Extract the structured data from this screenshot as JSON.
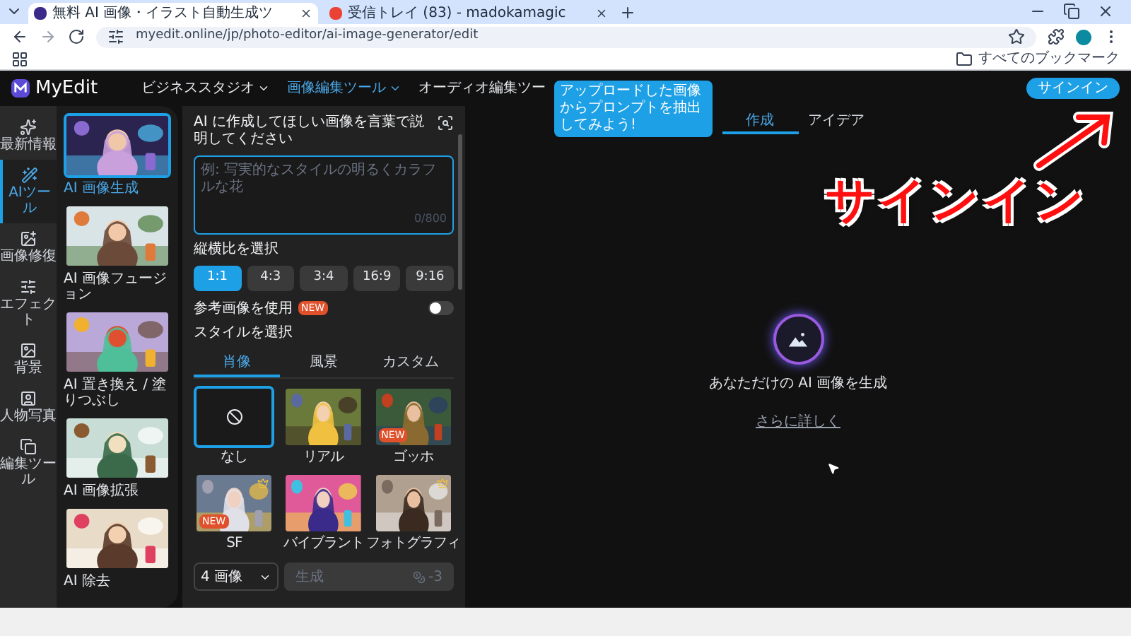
{
  "browser": {
    "tabs": [
      {
        "title": "無料 AI 画像・イラスト自動生成ツ",
        "selected": true
      },
      {
        "title": "受信トレイ (83) - madokamagic",
        "selected": false
      }
    ],
    "address": "myedit.online/jp/photo-editor/ai-image-generator/edit",
    "bookmarks": "すべてのブックマーク"
  },
  "header": {
    "logo": "MyEdit",
    "nav": [
      {
        "label": "ビジネススタジオ",
        "selected": false
      },
      {
        "label": "画像編集ツール",
        "selected": true
      },
      {
        "label": "オーディオ編集ツー",
        "selected": false
      }
    ],
    "sign_in": "サインイン"
  },
  "tooltip": "アップロードした画像からプロンプトを抽出してみよう!",
  "sidebar": {
    "items": [
      {
        "label": "最新情報",
        "selected": false
      },
      {
        "label": "AIツール",
        "selected": true
      },
      {
        "label": "画像修復",
        "selected": false
      },
      {
        "label": "エフェクト",
        "selected": false
      },
      {
        "label": "背景",
        "selected": false
      },
      {
        "label": "人物写真",
        "selected": false
      },
      {
        "label": "編集ツール",
        "selected": false
      }
    ]
  },
  "tools": [
    {
      "label": "AI 画像生成",
      "selected": true
    },
    {
      "label": "AI 画像フュージョン",
      "selected": false
    },
    {
      "label": "AI 置き換え / 塗りつぶし",
      "selected": false
    },
    {
      "label": "AI 画像拡張",
      "selected": false
    },
    {
      "label": "AI 除去",
      "selected": false
    }
  ],
  "prompt": {
    "label": "AI に作成してほしい画像を言葉で説明してください",
    "placeholder": "例: 写実的なスタイルの明るくカラフルな花",
    "counter": "0/800"
  },
  "aspect": {
    "label": "縦横比を選択",
    "options": [
      {
        "label": "1:1",
        "selected": true
      },
      {
        "label": "4:3",
        "selected": false
      },
      {
        "label": "3:4",
        "selected": false
      },
      {
        "label": "16:9",
        "selected": false
      },
      {
        "label": "9:16",
        "selected": false
      }
    ]
  },
  "reference": {
    "label": "参考画像を使用",
    "badge": "NEW",
    "on": false
  },
  "style": {
    "label": "スタイルを選択",
    "tabs": [
      {
        "label": "肖像",
        "selected": true
      },
      {
        "label": "風景",
        "selected": false
      },
      {
        "label": "カスタム",
        "selected": false
      }
    ],
    "items": [
      {
        "label": "なし",
        "kind": "none",
        "selected": true,
        "premium": false
      },
      {
        "label": "リアル",
        "kind": "picture",
        "selected": false,
        "premium": false
      },
      {
        "label": "ゴッホ",
        "kind": "picture",
        "selected": false,
        "badge": "NEW",
        "premium": false
      },
      {
        "label": "SF",
        "kind": "picture",
        "selected": false,
        "badge": "NEW",
        "premium": true
      },
      {
        "label": "バイブラント",
        "kind": "picture",
        "selected": false,
        "premium": false
      },
      {
        "label": "フォトグラフィ",
        "kind": "picture",
        "selected": false,
        "premium": true
      }
    ]
  },
  "count_select": "4 画像",
  "generate": {
    "label": "生成",
    "cost": "-3",
    "disabled": true
  },
  "main": {
    "tabs": [
      {
        "label": "作成",
        "selected": true
      },
      {
        "label": "アイデア",
        "selected": false
      }
    ],
    "title": "あなただけの AI 画像を生成",
    "link": "さらに詳しく"
  },
  "annotation": {
    "text": "サインイン"
  }
}
